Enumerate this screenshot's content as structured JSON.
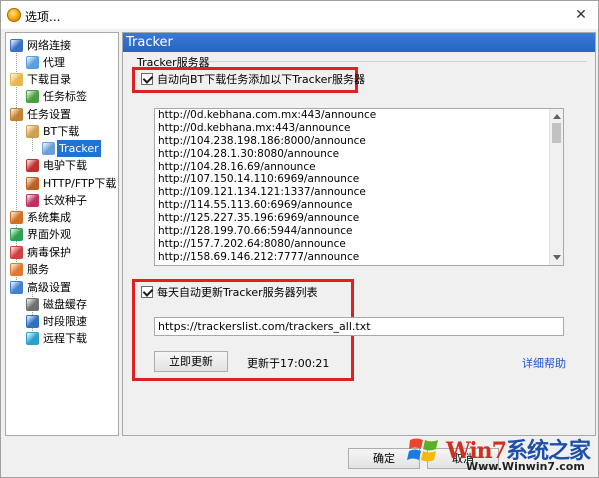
{
  "window": {
    "title": "选项...",
    "close_label": "✕"
  },
  "tree": {
    "items": [
      {
        "label": "网络连接",
        "icon": "network-icon"
      },
      {
        "label": "代理",
        "icon": "proxy-icon"
      },
      {
        "label": "下载目录",
        "icon": "folder-icon"
      },
      {
        "label": "任务标签",
        "icon": "tag-icon"
      },
      {
        "label": "任务设置",
        "icon": "task-settings-icon"
      },
      {
        "label": "BT下载",
        "icon": "bt-icon"
      },
      {
        "label": "Tracker",
        "icon": "tracker-icon"
      },
      {
        "label": "电驴下载",
        "icon": "emule-icon"
      },
      {
        "label": "HTTP/FTP下载",
        "icon": "http-ftp-icon"
      },
      {
        "label": "长效种子",
        "icon": "seed-icon"
      },
      {
        "label": "系统集成",
        "icon": "system-icon"
      },
      {
        "label": "界面外观",
        "icon": "appearance-icon"
      },
      {
        "label": "病毒保护",
        "icon": "virus-protection-icon"
      },
      {
        "label": "服务",
        "icon": "service-icon"
      },
      {
        "label": "高级设置",
        "icon": "advanced-icon"
      },
      {
        "label": "磁盘缓存",
        "icon": "disk-cache-icon"
      },
      {
        "label": "时段限速",
        "icon": "speed-limit-icon"
      },
      {
        "label": "远程下载",
        "icon": "remote-download-icon"
      }
    ],
    "selected": "Tracker"
  },
  "panel": {
    "header": "Tracker",
    "group_label": "Tracker服务器",
    "auto_add_label": "自动向BT下载任务添加以下Tracker服务器",
    "auto_add_checked": true,
    "trackers": [
      "http://0d.kebhana.com.mx:443/announce",
      "http://0d.kebhana.mx:443/announce",
      "http://104.238.198.186:8000/announce",
      "http://104.28.1.30:8080/announce",
      "http://104.28.16.69/announce",
      "http://107.150.14.110:6969/announce",
      "http://109.121.134.121:1337/announce",
      "http://114.55.113.60:6969/announce",
      "http://125.227.35.196:6969/announce",
      "http://128.199.70.66:5944/announce",
      "http://157.7.202.64:8080/announce",
      "http://158.69.146.212:7777/announce"
    ],
    "daily_update_label": "每天自动更新Tracker服务器列表",
    "daily_update_checked": true,
    "list_url": "https://trackerslist.com/trackers_all.txt",
    "update_now_label": "立即更新",
    "updated_at": "更新于17:00:21",
    "help_label": "详细帮助"
  },
  "footer": {
    "ok_label": "确定",
    "cancel_label": "取消"
  },
  "watermark": {
    "brand_a": "Win7",
    "brand_b": "系统之家",
    "url": "Www.Winwin7.com"
  },
  "colors": {
    "accent": "#2563c2",
    "highlight_box": "#e02020",
    "selection": "#1e73d4",
    "link": "#1a56c8"
  }
}
